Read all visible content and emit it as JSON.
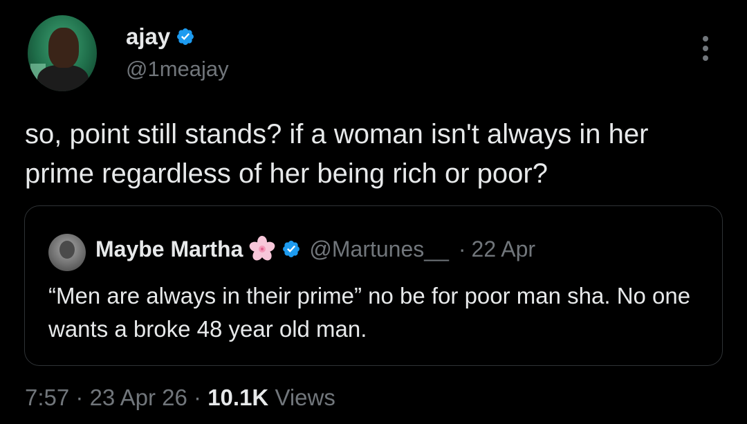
{
  "author": {
    "name": "ajay",
    "handle": "@1meajay",
    "verified": true
  },
  "tweet": {
    "text": "so, point still stands? if a woman isn't always in her prime regardless of her being rich or poor?"
  },
  "quoted_tweet": {
    "name": "Maybe Martha",
    "emoji": "cherry-blossom-icon",
    "verified": true,
    "handle": "@Martunes__",
    "separator": "·",
    "date": "22 Apr",
    "text": "“Men are always in their prime” no be for poor man sha. No one wants a broke 48 year old man."
  },
  "meta": {
    "time": "7:57",
    "sep1": "·",
    "date": "23 Apr 26",
    "sep2": "·",
    "views_count": "10.1K",
    "views_label": "Views"
  },
  "colors": {
    "background": "#000000",
    "text": "#e7e9ea",
    "secondary": "#71767b",
    "verified": "#1d9bf0",
    "border": "#2f3336"
  }
}
